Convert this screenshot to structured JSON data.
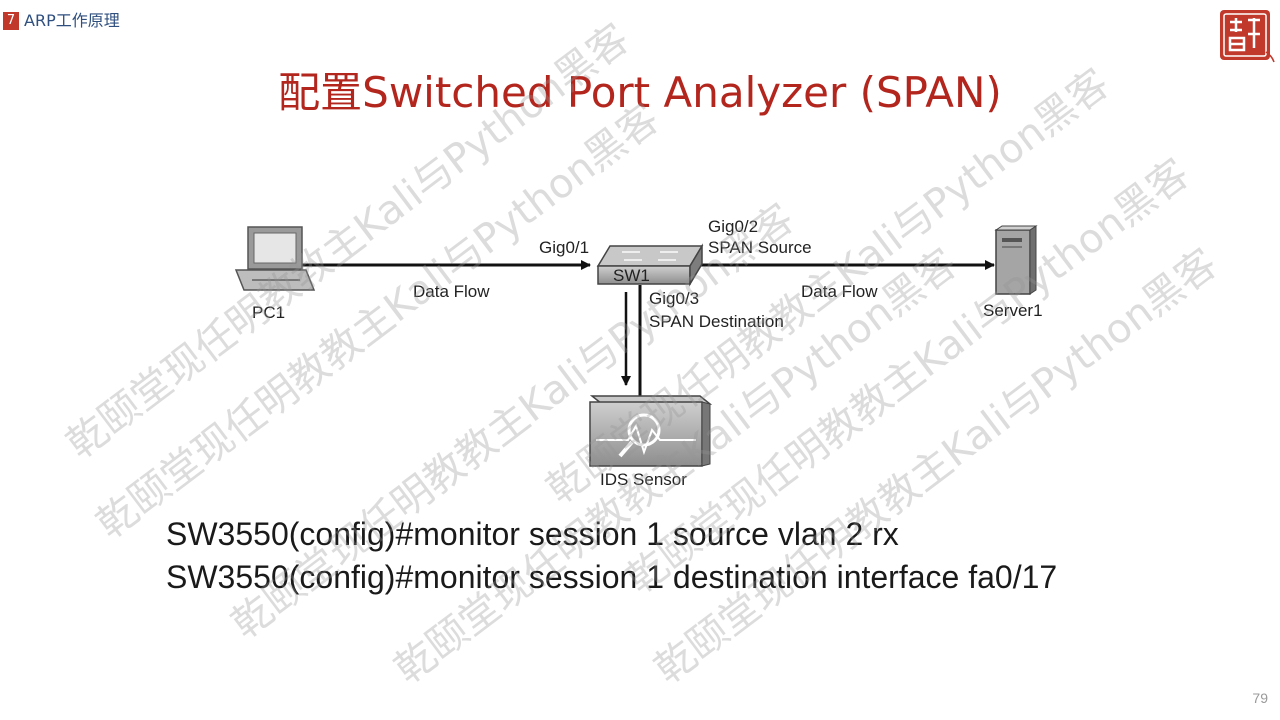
{
  "header": {
    "chapter_number": "7",
    "chapter_title": "ARP工作原理",
    "logo_text": "颐乾堂"
  },
  "title": "配置Switched Port Analyzer (SPAN)",
  "diagram": {
    "nodes": {
      "pc": "PC1",
      "switch": "SW1",
      "server": "Server1",
      "ids": "IDS Sensor"
    },
    "labels": {
      "gig01": "Gig0/1",
      "gig02": "Gig0/2",
      "span_source": "SPAN Source",
      "gig03": "Gig0/3",
      "span_destination": "SPAN Destination",
      "data_flow_left": "Data Flow",
      "data_flow_right": "Data Flow"
    }
  },
  "commands": [
    "SW3550(config)#monitor session 1 source vlan 2 rx",
    "SW3550(config)#monitor session 1 destination interface fa0/17"
  ],
  "watermark": "乾颐堂现任明教教主Kali与Python黑客",
  "page_number": "79"
}
